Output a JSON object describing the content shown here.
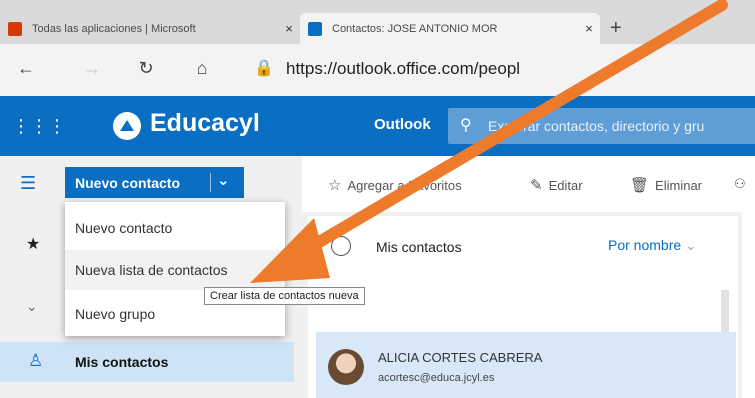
{
  "browser": {
    "tabs": [
      {
        "title": "Todas las aplicaciones | Microsoft",
        "favicon_color": "#d83b01"
      },
      {
        "title": "Contactos: JOSE ANTONIO MOR",
        "favicon_color": "#0a6fc2"
      }
    ],
    "close_glyph": "×",
    "new_tab_glyph": "+",
    "url": "https://outlook.office.com/peopl"
  },
  "topbar": {
    "brand": "Educacyl",
    "app_name": "Outlook",
    "search_placeholder": "Explorar contactos, directorio y gru"
  },
  "toolbar": {
    "new_contact_label": "Nuevo contacto",
    "favorites_label": "Agregar a Favoritos",
    "edit_label": "Editar",
    "delete_label": "Eliminar"
  },
  "dropdown": {
    "items": [
      "Nuevo contacto",
      "Nueva lista de contactos",
      "Nuevo grupo"
    ],
    "tooltip": "Crear lista de contactos nueva"
  },
  "nav": {
    "selected_label": "Mis contactos"
  },
  "list": {
    "title": "Mis contactos",
    "sort_label": "Por nombre",
    "contacts": [
      {
        "name": "ALICIA CORTES CABRERA",
        "email": "acortesc@educa.jcyl.es"
      }
    ]
  },
  "icons": {
    "back": "arrow-left-icon",
    "forward": "arrow-right-icon",
    "refresh": "refresh-icon",
    "home": "home-icon",
    "lock": "lock-icon",
    "waffle": "waffle-icon",
    "search": "search-icon",
    "hamburger": "hamburger-icon",
    "star": "star-icon",
    "person": "person-icon"
  },
  "colors": {
    "accent": "#0a6fc2",
    "annotation_arrow": "#ee7a2c"
  }
}
